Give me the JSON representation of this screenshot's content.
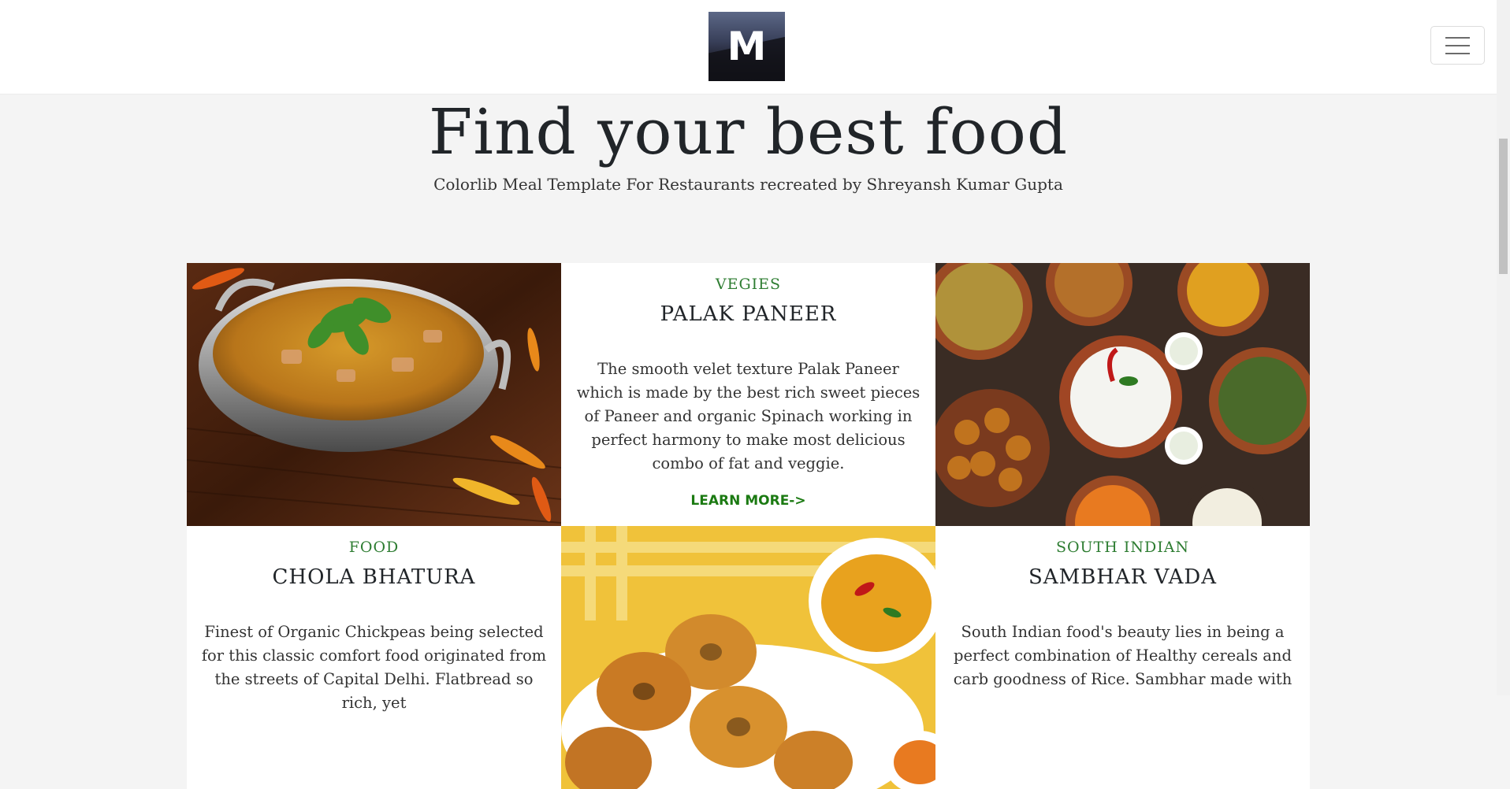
{
  "navbar": {
    "logo_letter": "M",
    "menu_icon": "hamburger-menu-icon"
  },
  "hero": {
    "title": "Find your best food",
    "subtitle": "Colorlib Meal Template For Restaurants recreated by Shreyansh Kumar Gupta"
  },
  "cards": [
    {
      "category": "VEGIES",
      "name": "PALAK PANEER",
      "description": "The smooth velet texture Palak Paneer which is made by the best rich sweet pieces of Paneer and organic Spinach working in perfect harmony to make most delicious combo of fat and veggie.",
      "link": "LEARN MORE->"
    },
    {
      "category": "FOOD",
      "name": "CHOLA BHATURA",
      "description": "Finest of Organic Chickpeas being selected for this classic comfort food originated from the streets of Capital Delhi. Flatbread so rich, yet"
    },
    {
      "category": "SOUTH INDIAN",
      "name": "SAMBHAR VADA",
      "description": "South Indian food's beauty lies in being a perfect combination of Healthy cereals and carb goodness of Rice. Sambhar made with"
    }
  ],
  "colors": {
    "accent_green": "#2e7d32",
    "link_green": "#1b7a12",
    "page_bg": "#f4f4f4"
  }
}
